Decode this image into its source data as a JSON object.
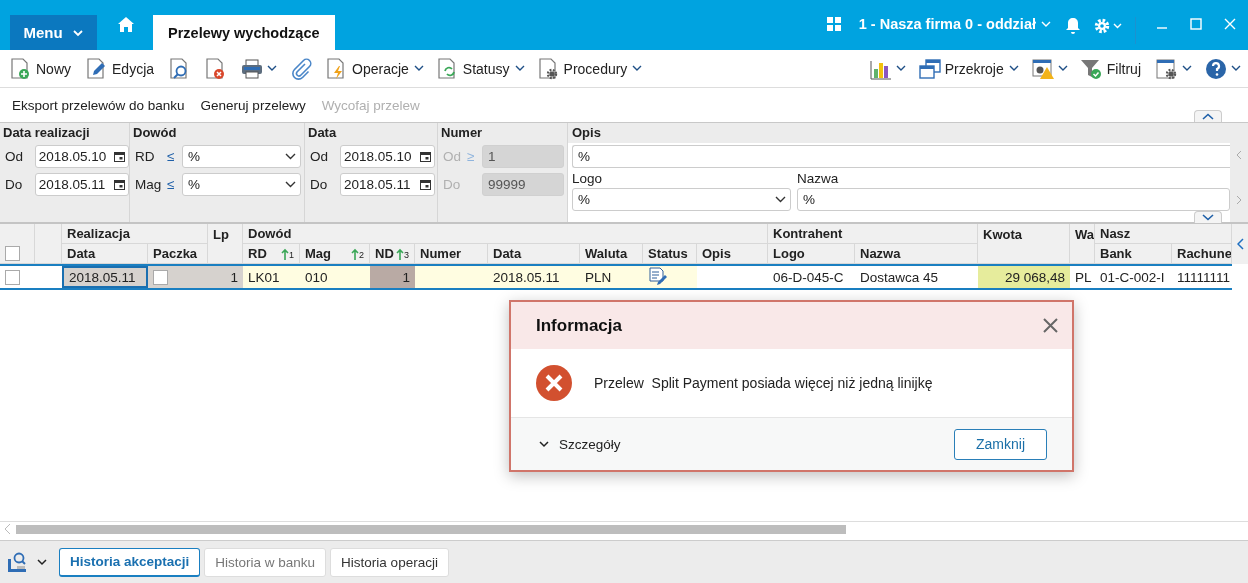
{
  "header": {
    "menu": "Menu",
    "tab": "Przelewy wychodzące",
    "company": "1 - Nasza firma 0 - oddział"
  },
  "toolbar": {
    "left": [
      {
        "label": "Nowy",
        "dropdown": false
      },
      {
        "label": "Edycja",
        "dropdown": false
      },
      {
        "dropdown": false
      },
      {
        "dropdown": false
      },
      {
        "dropdown": true
      },
      {
        "dropdown": false
      },
      {
        "label": "Operacje",
        "dropdown": true
      },
      {
        "label": "Statusy",
        "dropdown": true
      },
      {
        "label": "Procedury",
        "dropdown": true
      }
    ],
    "right": [
      {
        "dropdown": true
      },
      {
        "label": "Przekroje",
        "dropdown": true
      },
      {
        "dropdown": true
      },
      {
        "label": "Filtruj",
        "dropdown": false
      },
      {
        "dropdown": true
      },
      {
        "dropdown": true
      }
    ]
  },
  "actions": [
    {
      "label": "Eksport przelewów do banku",
      "disabled": false
    },
    {
      "label": "Generuj przelewy",
      "disabled": false
    },
    {
      "label": "Wycofaj przelew",
      "disabled": true
    }
  ],
  "filters": [
    {
      "kind": "dates",
      "title": "Data realizacji",
      "disabled": false,
      "rows": [
        {
          "label": "Od",
          "value": "2018.05.10"
        },
        {
          "label": "Do",
          "value": "2018.05.11"
        }
      ]
    },
    {
      "kind": "selects",
      "title": "Dowód",
      "disabled": false,
      "rows": [
        {
          "label": "RD",
          "operator": "≤",
          "value": "%"
        },
        {
          "label": "Mag",
          "operator": "≤",
          "value": "%"
        }
      ]
    },
    {
      "kind": "dates",
      "title": "Data",
      "disabled": false,
      "rows": [
        {
          "label": "Od",
          "value": "2018.05.10"
        },
        {
          "label": "Do",
          "value": "2018.05.11"
        }
      ]
    },
    {
      "kind": "numbers",
      "title": "Numer",
      "disabled": true,
      "rows": [
        {
          "label": "Od",
          "operator": "≥",
          "value": "1"
        },
        {
          "label": "Do",
          "value": "99999"
        }
      ]
    },
    {
      "kind": "description",
      "title": "Opis",
      "value": "%",
      "logo_label": "Logo",
      "logo": "%",
      "name_label": "Nazwa",
      "name": "%"
    }
  ],
  "grid": {
    "select_all": {
      "checked": false
    },
    "groups": [
      {
        "label": "Realizacja",
        "columns": [
          {
            "label": "Data"
          },
          {
            "label": "Paczka"
          }
        ]
      },
      {
        "label": "Lp"
      },
      {
        "label": "Dowód",
        "columns": [
          {
            "label": "RD",
            "sort": "1"
          },
          {
            "label": "Mag",
            "sort": "2"
          },
          {
            "label": "ND",
            "sort": "3"
          },
          {
            "label": "Numer"
          },
          {
            "label": "Data"
          },
          {
            "label": "Waluta"
          },
          {
            "label": "Status"
          },
          {
            "label": "Opis"
          }
        ]
      },
      {
        "label": "Kontrahent",
        "columns": [
          {
            "label": "Logo"
          },
          {
            "label": "Nazwa"
          }
        ]
      },
      {
        "label": "Kwota"
      },
      {
        "label": "Wa"
      },
      {
        "label": "Nasz",
        "columns": [
          {
            "label": "Bank"
          },
          {
            "label": "Rachune"
          }
        ]
      }
    ],
    "row": {
      "selected": true,
      "cells": [
        {
          "kind": "checkbox",
          "checked": false,
          "color": "#ffffff",
          "focused": false
        },
        {
          "kind": "empty",
          "color": "#ffffff",
          "focused": false
        },
        {
          "kind": "text",
          "text": "2018.05.11",
          "color": "#d6d2ce",
          "focused": true
        },
        {
          "kind": "checkbox",
          "checked": false,
          "color": "#d6d2ce",
          "focused": false
        },
        {
          "kind": "number",
          "text": "1",
          "color": "#d6d2ce",
          "focused": false
        },
        {
          "kind": "text",
          "text": "LK01",
          "color": "#fffde1",
          "focused": false
        },
        {
          "kind": "text",
          "text": "010",
          "color": "#fffde1",
          "focused": false
        },
        {
          "kind": "number",
          "text": "1",
          "color": "#b9aaa4",
          "focused": false
        },
        {
          "kind": "empty",
          "color": "#fffde1",
          "focused": false
        },
        {
          "kind": "text",
          "text": "2018.05.11",
          "color": "#fffde1",
          "focused": false
        },
        {
          "kind": "text",
          "text": "PLN",
          "color": "#fffde1",
          "focused": false
        },
        {
          "kind": "icon",
          "color": "#fffde1",
          "focused": false
        },
        {
          "kind": "empty",
          "color": "#ffffff",
          "focused": false
        },
        {
          "kind": "text",
          "text": "06-D-045-C",
          "color": "#ffffff",
          "focused": false
        },
        {
          "kind": "text",
          "text": "Dostawca 45",
          "color": "#ffffff",
          "focused": false
        },
        {
          "kind": "number",
          "text": "29 068,48",
          "color": "#e6ec9c",
          "focused": false
        },
        {
          "kind": "text",
          "text": "PL",
          "color": "#ffffff",
          "focused": false
        },
        {
          "kind": "text",
          "text": "01-C-002-I",
          "color": "#ffffff",
          "focused": false
        },
        {
          "kind": "text",
          "text": "11111111",
          "color": "#ffffff",
          "focused": false
        }
      ]
    }
  },
  "dialog": {
    "title": "Informacja",
    "message": "Przelew  Split Payment posiada więcej niż jedną linijkę",
    "details": "Szczegóły",
    "button": "Zamknij"
  },
  "bottom_tabs": [
    {
      "label": "Historia akceptacji",
      "selected": true,
      "disabled": false
    },
    {
      "label": "Historia w banku",
      "selected": false,
      "disabled": true
    },
    {
      "label": "Historia operacji",
      "selected": false,
      "disabled": false
    }
  ]
}
